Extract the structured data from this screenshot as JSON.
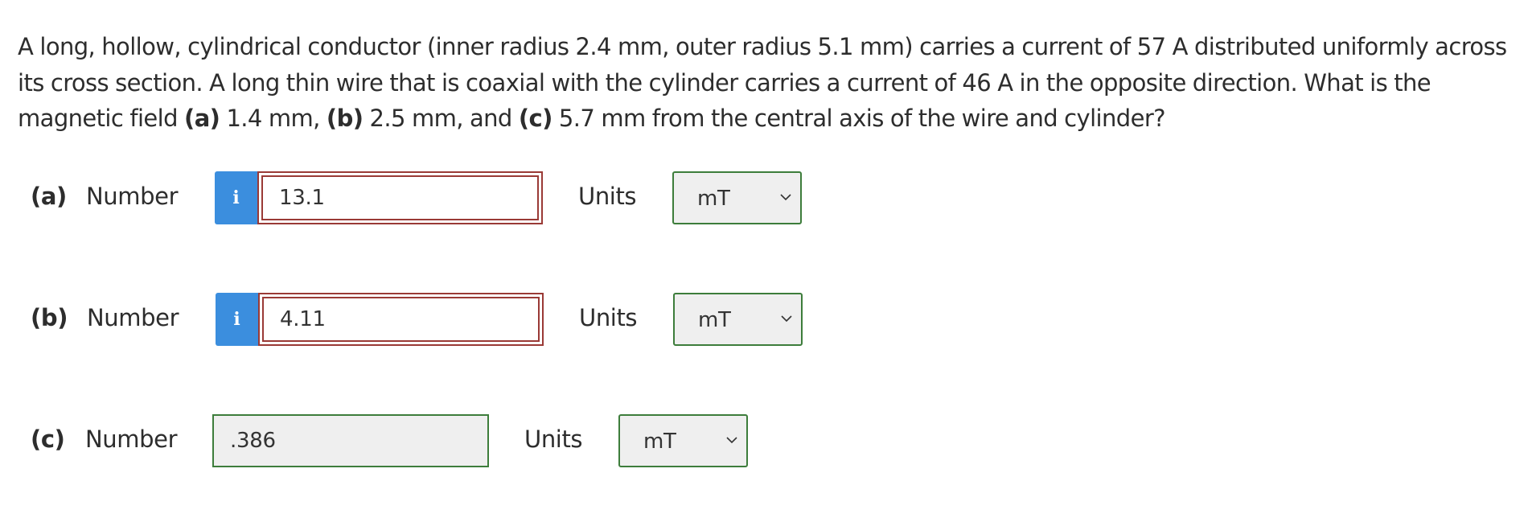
{
  "question": {
    "line1": "A long, hollow, cylindrical conductor (inner radius 2.4 mm, outer radius 5.1 mm) carries a current of 57 A distributed uniformly across",
    "line2": "its cross section. A long thin wire that is coaxial with the cylinder carries a current of 46 A in the opposite direction. What is the",
    "line3_pre": "magnetic field ",
    "line3_a_label": "(a)",
    "line3_a_text": " 1.4 mm, ",
    "line3_b_label": "(b)",
    "line3_b_text": " 2.5 mm, and ",
    "line3_c_label": "(c)",
    "line3_c_text": " 5.7 mm from the central axis of the wire and cylinder?"
  },
  "parts": {
    "a": {
      "label": "(a)",
      "number_label": "Number",
      "info_icon": "i",
      "value": "13.1",
      "units_label": "Units",
      "units_value": "mT"
    },
    "b": {
      "label": "(b)",
      "number_label": "Number",
      "info_icon": "i",
      "value": "4.11",
      "units_label": "Units",
      "units_value": "mT"
    },
    "c": {
      "label": "(c)",
      "number_label": "Number",
      "value": ".386",
      "units_label": "Units",
      "units_value": "mT"
    }
  },
  "icons": {
    "info": "info-icon",
    "dropdown": "chevron-down-icon"
  },
  "colors": {
    "info_button": "#3b8ede",
    "incorrect_border": "#9a3a36",
    "correct_border": "#3d7d3b",
    "field_background": "#efefef",
    "text": "#2d2d2d"
  }
}
